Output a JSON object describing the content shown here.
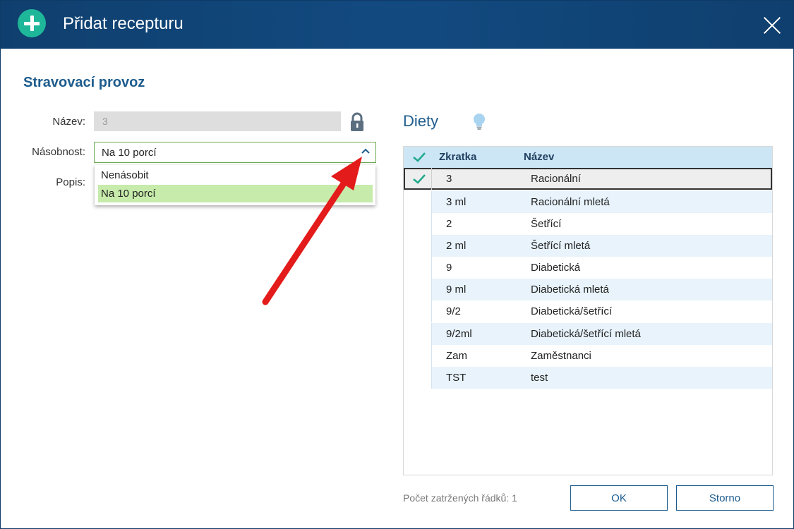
{
  "window": {
    "title": "Přidat recepturu"
  },
  "section_title": "Stravovací provoz",
  "form": {
    "name_label": "Název:",
    "name_value": "3",
    "multiplicity_label": "Násobnost:",
    "multiplicity_value": "Na 10 porcí",
    "description_label": "Popis:",
    "options": [
      "Nenásobit",
      "Na 10 porcí"
    ],
    "selected_option": "Na 10 porcí"
  },
  "diets": {
    "title": "Diety",
    "columns": [
      "Zkratka",
      "Název"
    ],
    "rows": [
      {
        "code": "3",
        "name": "Racionální",
        "checked": true
      },
      {
        "code": "3 ml",
        "name": "Racionální mletá",
        "checked": false
      },
      {
        "code": "2",
        "name": "Šetřící",
        "checked": false
      },
      {
        "code": "2 ml",
        "name": "Šetřící mletá",
        "checked": false
      },
      {
        "code": "9",
        "name": "Diabetická",
        "checked": false
      },
      {
        "code": "9 ml",
        "name": "Diabetická mletá",
        "checked": false
      },
      {
        "code": "9/2",
        "name": "Diabetická/šetřící",
        "checked": false
      },
      {
        "code": "9/2ml",
        "name": "Diabetická/šetřící mletá",
        "checked": false
      },
      {
        "code": "Zam",
        "name": "Zaměstnanci",
        "checked": false
      },
      {
        "code": "TST",
        "name": "test",
        "checked": false
      }
    ],
    "checked_count_text": "Počet zatržených řádků: 1"
  },
  "buttons": {
    "ok": "OK",
    "cancel": "Storno"
  },
  "icons": {
    "title": "plus-circle-icon",
    "close": "close-icon",
    "lock": "lock-icon",
    "dropdown": "chevron-up-icon",
    "hint": "lightbulb-icon",
    "check": "checkmark-icon",
    "annotation": "red-arrow"
  },
  "colors": {
    "title_bar": "#124a80",
    "accent": "#1d5c8e",
    "plus_icon": "#1fb79a",
    "selected_option": "#c6ebaa",
    "grid_header": "#cde6f6",
    "alt_row": "#e8f3fb",
    "annotation_arrow": "#e31b1b"
  }
}
